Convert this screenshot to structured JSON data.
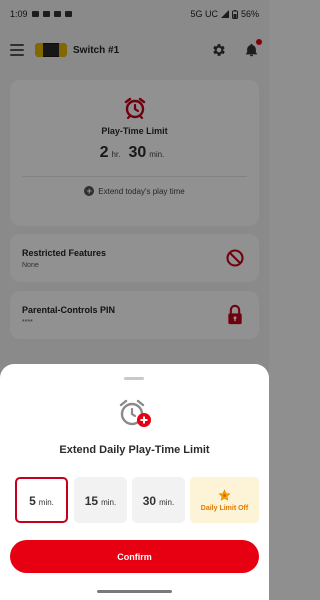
{
  "status_bar": {
    "time": "1:09",
    "network": "5G UC",
    "battery": "56%"
  },
  "app_bar": {
    "console_name": "Switch #1"
  },
  "play_time_card": {
    "title": "Play-Time Limit",
    "hours": "2",
    "hours_unit": "hr.",
    "minutes": "30",
    "minutes_unit": "min.",
    "extend_label": "Extend today's play time"
  },
  "restricted_card": {
    "title": "Restricted Features",
    "value": "None"
  },
  "pin_card": {
    "title": "Parental-Controls PIN",
    "value": "****"
  },
  "sheet": {
    "title": "Extend Daily Play-Time Limit",
    "options": [
      {
        "value": "5",
        "unit": "min.",
        "selected": true
      },
      {
        "value": "15",
        "unit": "min.",
        "selected": false
      },
      {
        "value": "30",
        "unit": "min.",
        "selected": false
      }
    ],
    "off_option": "Daily Limit Off",
    "confirm_label": "Confirm"
  },
  "colors": {
    "brand_red": "#e60012",
    "selected_border": "#c4001a",
    "limit_off_bg": "#fdf3d6",
    "limit_off_text": "#e07a00"
  },
  "icons": [
    "menu-icon",
    "gear-icon",
    "bell-icon",
    "alarm-clock-icon",
    "plus-circle-icon",
    "prohibited-icon",
    "lock-icon",
    "alarm-clock-add-icon",
    "star-icon"
  ]
}
